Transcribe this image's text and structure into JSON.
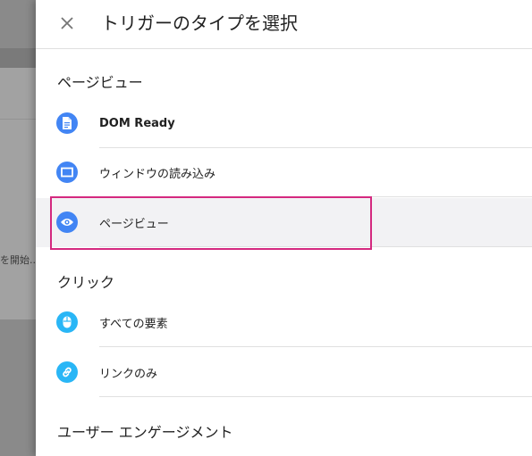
{
  "background": {
    "truncated_text": "を開始..."
  },
  "dialog": {
    "title": "トリガーのタイプを選択",
    "close_icon": "close-icon"
  },
  "sections": [
    {
      "heading": "ページビュー",
      "items": [
        {
          "label": "DOM Ready",
          "icon": "document-icon",
          "icon_color": "#4285f4"
        },
        {
          "label": "ウィンドウの読み込み",
          "icon": "window-icon",
          "icon_color": "#4285f4"
        },
        {
          "label": "ページビュー",
          "icon": "eye-icon",
          "icon_color": "#4285f4"
        }
      ]
    },
    {
      "heading": "クリック",
      "items": [
        {
          "label": "すべての要素",
          "icon": "mouse-icon",
          "icon_color": "#29b6f6"
        },
        {
          "label": "リンクのみ",
          "icon": "link-icon",
          "icon_color": "#29b6f6"
        }
      ]
    },
    {
      "heading": "ユーザー エンゲージメント",
      "items": []
    }
  ],
  "colors": {
    "highlight_border": "#d4297f",
    "hover_background": "#f2f2f4"
  }
}
